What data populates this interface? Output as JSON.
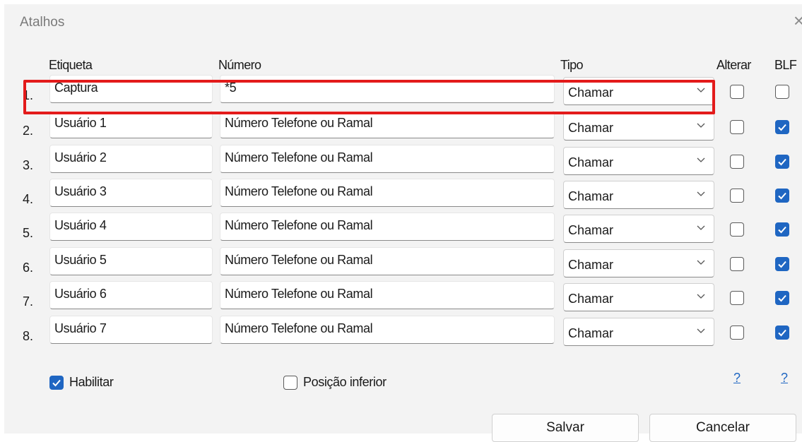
{
  "dialog": {
    "title": "Atalhos",
    "close_glyph": "×"
  },
  "headers": {
    "label": "Etiqueta",
    "number": "Número",
    "type": "Tipo",
    "change": "Alterar",
    "blf": "BLF"
  },
  "rows": [
    {
      "num": "1.",
      "label": "Captura",
      "number": "*5",
      "type": "Chamar",
      "alterar": false,
      "blf": false
    },
    {
      "num": "2.",
      "label": "Usuário 1",
      "number": "Número Telefone ou Ramal",
      "type": "Chamar",
      "alterar": false,
      "blf": true
    },
    {
      "num": "3.",
      "label": "Usuário 2",
      "number": "Número Telefone ou Ramal",
      "type": "Chamar",
      "alterar": false,
      "blf": true
    },
    {
      "num": "4.",
      "label": "Usuário 3",
      "number": "Número Telefone ou Ramal",
      "type": "Chamar",
      "alterar": false,
      "blf": true
    },
    {
      "num": "5.",
      "label": "Usuário 4",
      "number": "Número Telefone ou Ramal",
      "type": "Chamar",
      "alterar": false,
      "blf": true
    },
    {
      "num": "6.",
      "label": "Usuário 5",
      "number": "Número Telefone ou Ramal",
      "type": "Chamar",
      "alterar": false,
      "blf": true
    },
    {
      "num": "7.",
      "label": "Usuário 6",
      "number": "Número Telefone ou Ramal",
      "type": "Chamar",
      "alterar": false,
      "blf": true
    },
    {
      "num": "8.",
      "label": "Usuário 7",
      "number": "Número Telefone ou Ramal",
      "type": "Chamar",
      "alterar": false,
      "blf": true
    }
  ],
  "options": {
    "enable_label": "Habilitar",
    "enable_checked": true,
    "bottom_position_label": "Posição inferior",
    "bottom_position_checked": false
  },
  "help": {
    "alterar_help": "?",
    "blf_help": "?"
  },
  "buttons": {
    "save": "Salvar",
    "cancel": "Cancelar"
  },
  "colors": {
    "accent": "#1f66c2",
    "highlight": "#e31b1b"
  }
}
